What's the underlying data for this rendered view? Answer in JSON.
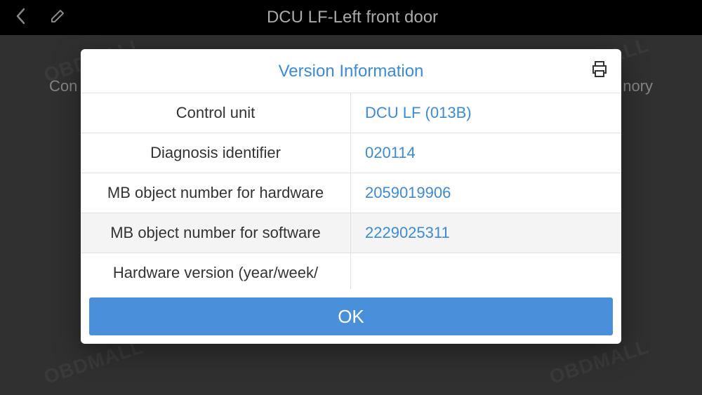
{
  "header": {
    "title": "DCU LF-Left front door"
  },
  "background": {
    "left_text": "Con",
    "right_text": "nory"
  },
  "dialog": {
    "title": "Version Information",
    "ok_label": "OK",
    "rows": [
      {
        "label": "Control unit",
        "value": "DCU LF (013B)"
      },
      {
        "label": "Diagnosis identifier",
        "value": "020114"
      },
      {
        "label": "MB object number for hardware",
        "value": "2059019906"
      },
      {
        "label": "MB object number for software",
        "value": "2229025311"
      },
      {
        "label": "Hardware version (year/week/",
        "value": ""
      }
    ]
  },
  "watermark": "OBDMALL"
}
